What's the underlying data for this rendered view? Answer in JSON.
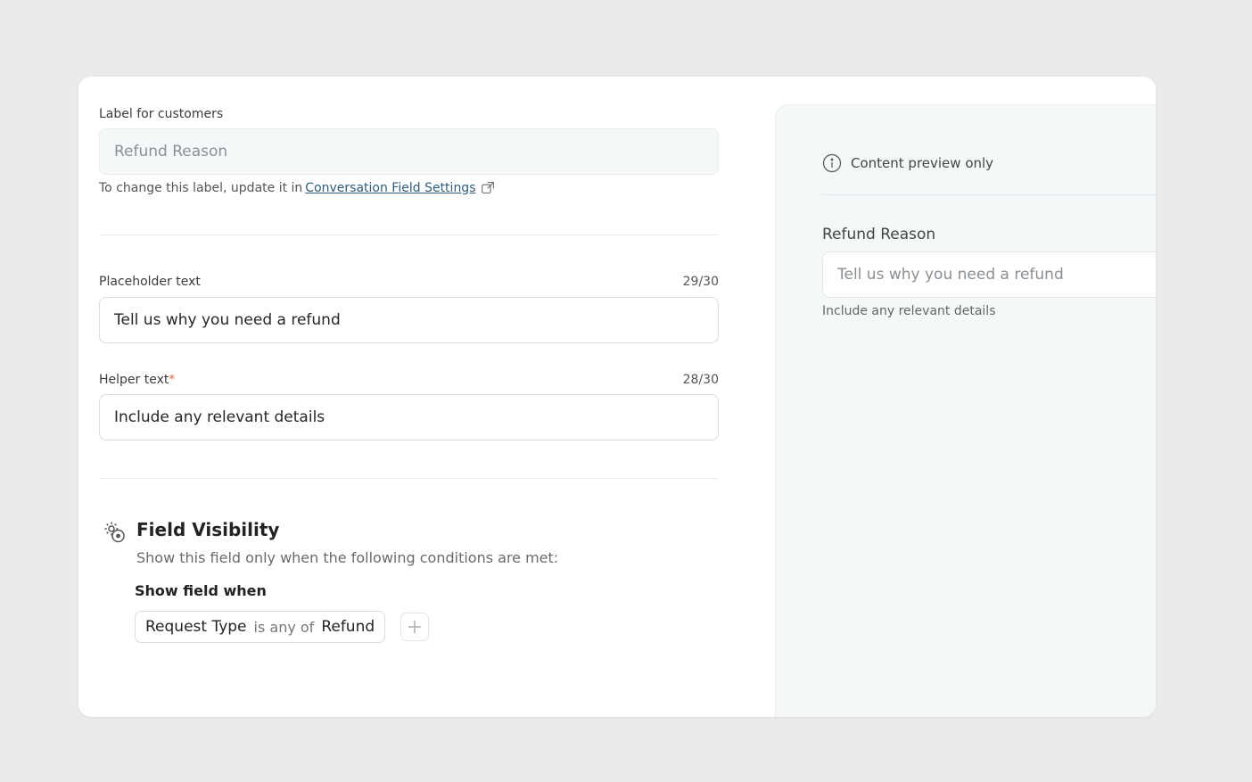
{
  "label_section": {
    "label": "Label for customers",
    "value": "Refund Reason",
    "note_prefix": "To change this label, update it in",
    "note_link": "Conversation Field Settings"
  },
  "placeholder_section": {
    "label": "Placeholder text",
    "count": "29/30",
    "value": "Tell us why you need a refund"
  },
  "helper_section": {
    "label": "Helper text",
    "required_mark": "*",
    "count": "28/30",
    "value": "Include any relevant details"
  },
  "visibility": {
    "icon": "visibility-settings-icon",
    "title": "Field Visibility",
    "subtitle": "Show this field only when the following conditions are met:",
    "show_when": "Show field when",
    "condition": {
      "field": "Request Type",
      "operator": "is any of",
      "value": "Refund"
    },
    "add_label": "+"
  },
  "preview": {
    "info_icon": "info-icon",
    "info_text": "Content preview only",
    "field_label": "Refund Reason",
    "placeholder": "Tell us why you need a refund",
    "helper": "Include any relevant details"
  },
  "colors": {
    "background": "#ebebeb",
    "card": "#ffffff",
    "preview_panel": "#f5f8f9",
    "link": "#2f5d7a",
    "required": "#e06a4f"
  }
}
